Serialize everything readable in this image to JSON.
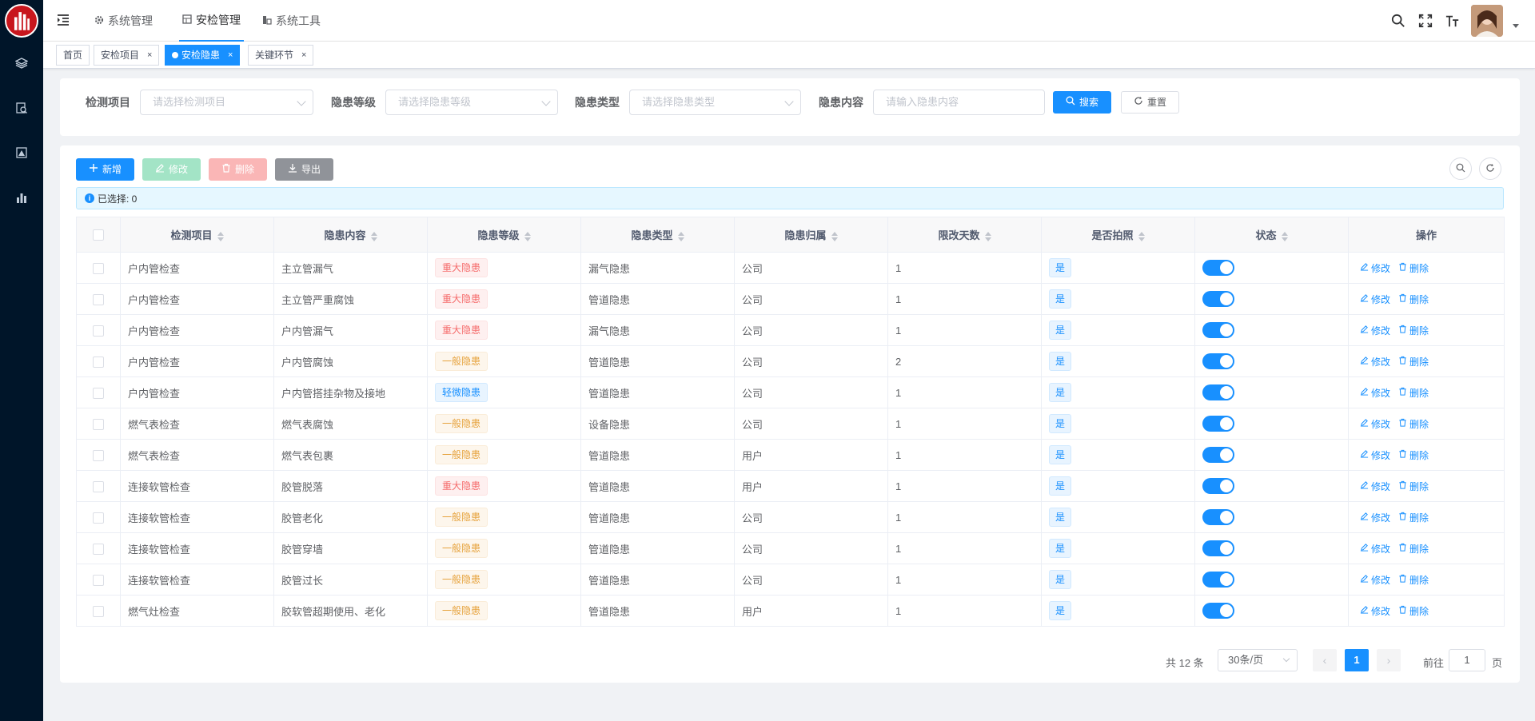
{
  "header": {
    "menu": [
      {
        "label": "系统管理",
        "icon": "gear-icon"
      },
      {
        "label": "安检管理",
        "icon": "grid-icon"
      },
      {
        "label": "系统工具",
        "icon": "tools-icon"
      }
    ]
  },
  "tags": [
    {
      "label": "首页",
      "active": false,
      "closable": false
    },
    {
      "label": "安检项目",
      "active": false,
      "closable": true
    },
    {
      "label": "安检隐患",
      "active": true,
      "closable": true
    },
    {
      "label": "关键环节",
      "active": false,
      "closable": true
    }
  ],
  "search": {
    "fields": [
      {
        "label": "检测项目",
        "placeholder": "请选择检测项目",
        "type": "select"
      },
      {
        "label": "隐患等级",
        "placeholder": "请选择隐患等级",
        "type": "select"
      },
      {
        "label": "隐患类型",
        "placeholder": "请选择隐患类型",
        "type": "select"
      },
      {
        "label": "隐患内容",
        "placeholder": "请输入隐患内容",
        "type": "input"
      }
    ],
    "search_btn": "搜索",
    "reset_btn": "重置"
  },
  "toolbar": {
    "add": "新增",
    "edit": "修改",
    "delete": "删除",
    "export": "导出"
  },
  "selection": {
    "text": "已选择: 0"
  },
  "table": {
    "columns": [
      "检测项目",
      "隐患内容",
      "隐患等级",
      "隐患类型",
      "隐患归属",
      "限改天数",
      "是否拍照",
      "状态",
      "操作"
    ],
    "rows": [
      {
        "project": "户内管检查",
        "content": "主立管漏气",
        "level": "重大隐患",
        "level_color": "red",
        "type": "漏气隐患",
        "owner": "公司",
        "days": "1",
        "photo": "是"
      },
      {
        "project": "户内管检查",
        "content": "主立管严重腐蚀",
        "level": "重大隐患",
        "level_color": "red",
        "type": "管道隐患",
        "owner": "公司",
        "days": "1",
        "photo": "是"
      },
      {
        "project": "户内管检查",
        "content": "户内管漏气",
        "level": "重大隐患",
        "level_color": "red",
        "type": "漏气隐患",
        "owner": "公司",
        "days": "1",
        "photo": "是"
      },
      {
        "project": "户内管检查",
        "content": "户内管腐蚀",
        "level": "一般隐患",
        "level_color": "orange",
        "type": "管道隐患",
        "owner": "公司",
        "days": "2",
        "photo": "是"
      },
      {
        "project": "户内管检查",
        "content": "户内管搭挂杂物及接地",
        "level": "轻微隐患",
        "level_color": "blue",
        "type": "管道隐患",
        "owner": "公司",
        "days": "1",
        "photo": "是"
      },
      {
        "project": "燃气表检查",
        "content": "燃气表腐蚀",
        "level": "一般隐患",
        "level_color": "orange",
        "type": "设备隐患",
        "owner": "公司",
        "days": "1",
        "photo": "是"
      },
      {
        "project": "燃气表检查",
        "content": "燃气表包裹",
        "level": "一般隐患",
        "level_color": "orange",
        "type": "管道隐患",
        "owner": "用户",
        "days": "1",
        "photo": "是"
      },
      {
        "project": "连接软管检查",
        "content": "胶管脱落",
        "level": "重大隐患",
        "level_color": "red",
        "type": "管道隐患",
        "owner": "用户",
        "days": "1",
        "photo": "是"
      },
      {
        "project": "连接软管检查",
        "content": "胶管老化",
        "level": "一般隐患",
        "level_color": "orange",
        "type": "管道隐患",
        "owner": "公司",
        "days": "1",
        "photo": "是"
      },
      {
        "project": "连接软管检查",
        "content": "胶管穿墙",
        "level": "一般隐患",
        "level_color": "orange",
        "type": "管道隐患",
        "owner": "公司",
        "days": "1",
        "photo": "是"
      },
      {
        "project": "连接软管检查",
        "content": "胶管过长",
        "level": "一般隐患",
        "level_color": "orange",
        "type": "管道隐患",
        "owner": "公司",
        "days": "1",
        "photo": "是"
      },
      {
        "project": "燃气灶检查",
        "content": "胶软管超期使用、老化",
        "level": "一般隐患",
        "level_color": "orange",
        "type": "管道隐患",
        "owner": "用户",
        "days": "1",
        "photo": "是"
      }
    ],
    "row_ops": {
      "edit": "修改",
      "delete": "删除"
    }
  },
  "pagination": {
    "total_text": "共 12 条",
    "page_size": "30条/页",
    "current_page": "1",
    "goto_label": "前往",
    "goto_value": "1",
    "goto_suffix": "页"
  },
  "colors": {
    "primary": "#1890ff",
    "sidebar": "#001529",
    "danger": "#f56c6c",
    "warning": "#e6a23c"
  }
}
